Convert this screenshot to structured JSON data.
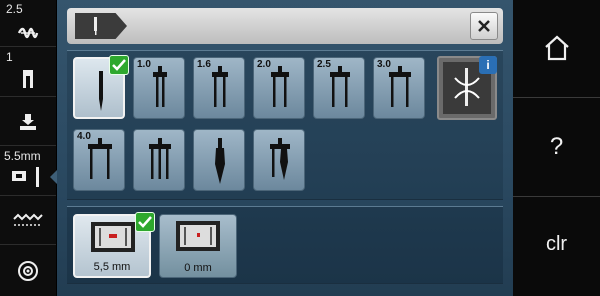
{
  "left_status": {
    "stitch_width": "2.5",
    "stitch_length": "1",
    "needle_position": "5.5mm"
  },
  "needles": [
    {
      "label": "",
      "selected": true
    },
    {
      "label": "1.0"
    },
    {
      "label": "1.6"
    },
    {
      "label": "2.0"
    },
    {
      "label": "2.5"
    },
    {
      "label": "3.0"
    },
    {
      "label": "4.0"
    },
    {
      "label": ""
    },
    {
      "label": ""
    },
    {
      "label": ""
    }
  ],
  "info_badge": "i",
  "stitch_plates": [
    {
      "label": "5,5 mm",
      "selected": true
    },
    {
      "label": "0 mm"
    }
  ],
  "right_bar": {
    "clear_label": "clr",
    "help_label": "?"
  },
  "colors": {
    "check": "#2ea82e",
    "info": "#2a6fb5",
    "panel": "#2b4a62"
  }
}
